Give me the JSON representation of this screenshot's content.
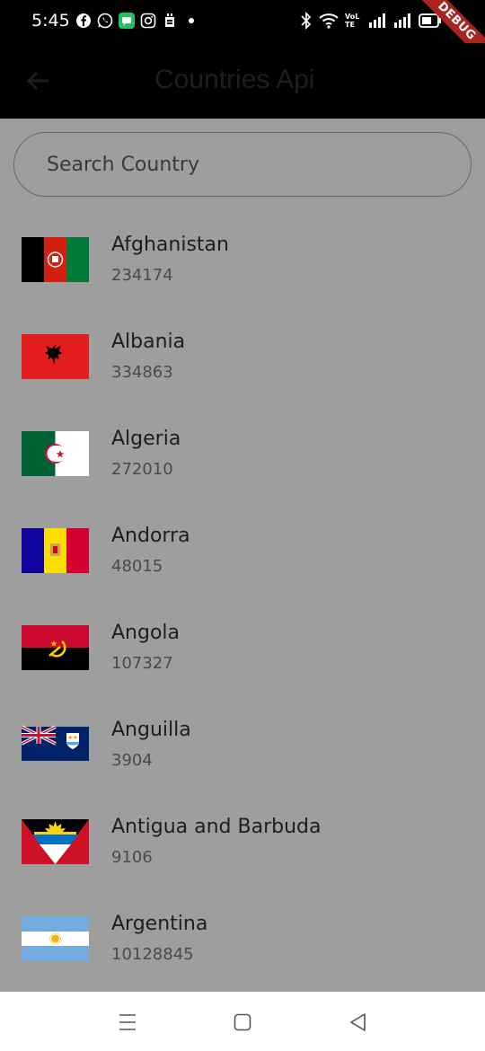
{
  "status_bar": {
    "time": "5:45",
    "notification_icons": [
      "facebook-icon",
      "whatsapp-icon",
      "messages-icon",
      "instagram-icon",
      "sim-toolkit-icon",
      "dot-icon"
    ],
    "system_icons": [
      "bluetooth-icon",
      "wifi-icon",
      "volte-icon",
      "signal-icon",
      "signal-icon",
      "battery-icon"
    ],
    "volte_text": "VoLTE"
  },
  "debug_banner": "DEBUG",
  "app_bar": {
    "title": "Countries Api",
    "back_icon": "arrow-back-icon"
  },
  "search": {
    "placeholder": "Search Country",
    "value": ""
  },
  "countries": [
    {
      "name": "Afghanistan",
      "population": "234174"
    },
    {
      "name": "Albania",
      "population": "334863"
    },
    {
      "name": "Algeria",
      "population": "272010"
    },
    {
      "name": "Andorra",
      "population": "48015"
    },
    {
      "name": "Angola",
      "population": "107327"
    },
    {
      "name": "Anguilla",
      "population": "3904"
    },
    {
      "name": "Antigua and Barbuda",
      "population": "9106"
    },
    {
      "name": "Argentina",
      "population": "10128845"
    }
  ],
  "nav_bar": {
    "icons": [
      "menu-icon",
      "home-icon",
      "back-icon"
    ]
  },
  "colors": {
    "status_bar": "#000000",
    "app_bar": "#000000",
    "content_bg": "#9e9e9e",
    "debug_banner": "#a8241f",
    "nav_bar": "#ffffff"
  }
}
